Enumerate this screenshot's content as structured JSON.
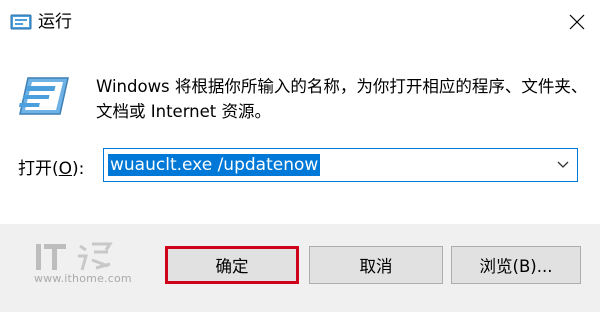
{
  "window": {
    "title": "运行"
  },
  "description": "Windows 将根据你所输入的名称，为你打开相应的程序、文件夹、文档或 Internet 资源。",
  "open_field": {
    "label_prefix": "打开(",
    "label_access_key": "O",
    "label_suffix": "):",
    "value": "wuauclt.exe /updatenow"
  },
  "buttons": {
    "ok_label": "确定",
    "cancel_label": "取消",
    "browse_label": "浏览(B)..."
  },
  "watermark": {
    "site": "www.ithome.com"
  },
  "colors": {
    "accent": "#0078d7",
    "highlight_border": "#d0021b",
    "footer_bg": "#f0f0f0"
  },
  "icons": {
    "app": "run-dialog-icon",
    "close": "close-icon",
    "dropdown": "chevron-down-icon"
  }
}
